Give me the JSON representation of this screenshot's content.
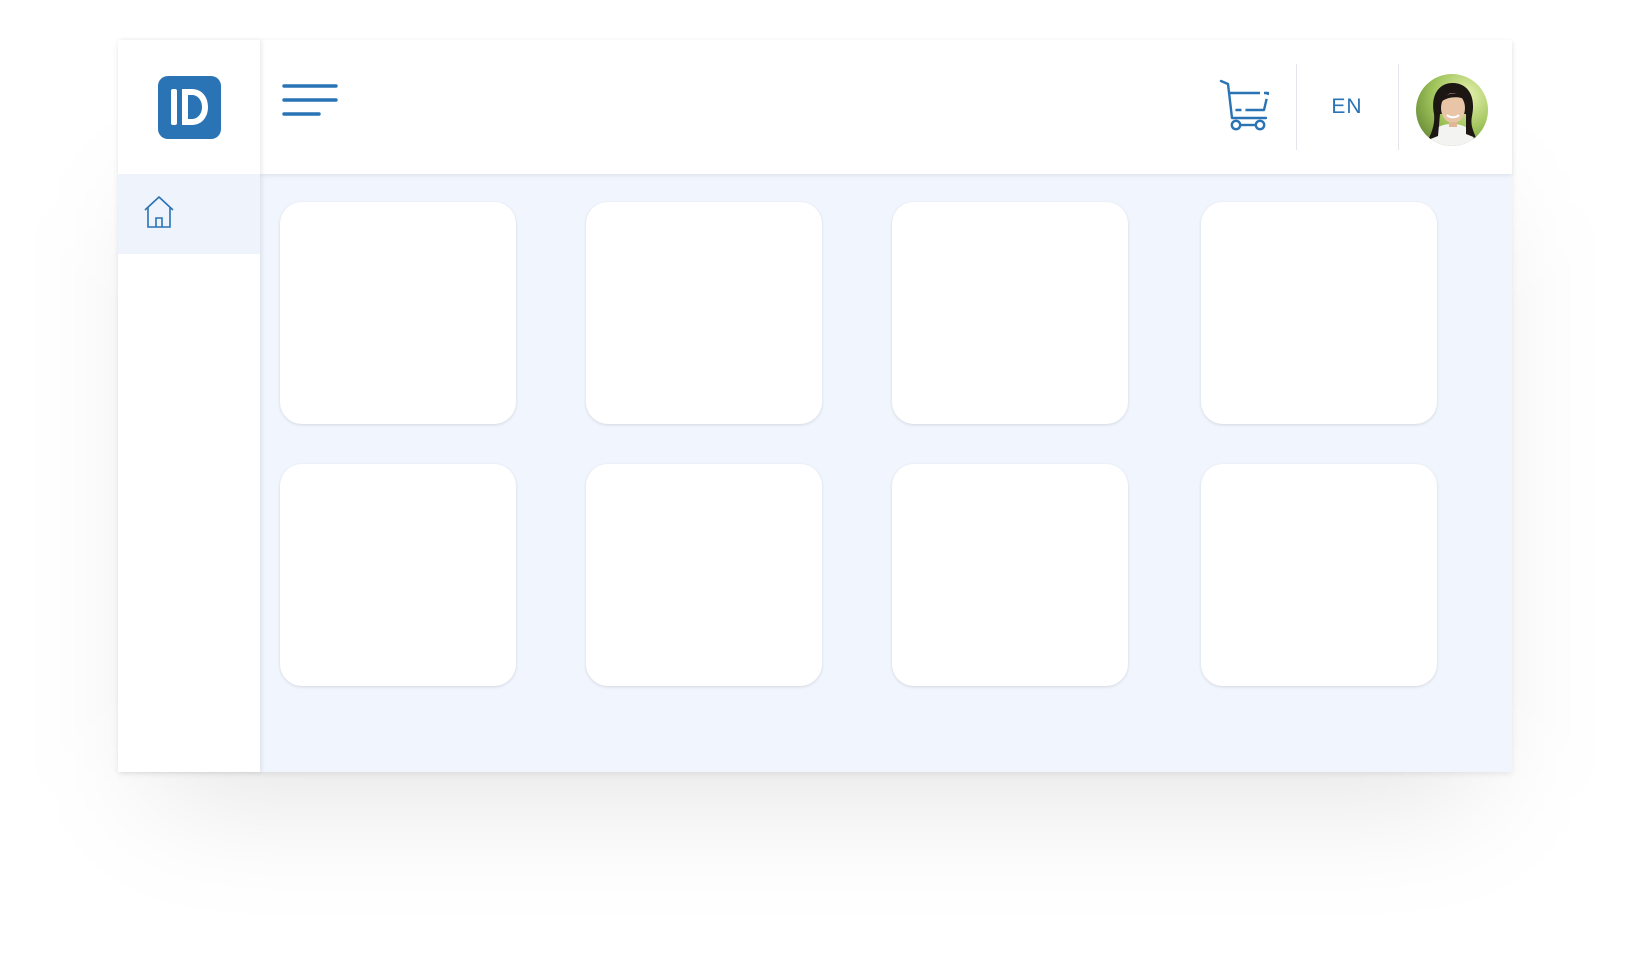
{
  "header": {
    "logo_icon": "id-logo-icon",
    "menu_icon": "hamburger-menu-icon",
    "cart_icon": "shopping-cart-icon",
    "language": "EN",
    "avatar_icon": "user-avatar"
  },
  "sidebar": {
    "items": [
      {
        "icon": "home-icon",
        "active": true
      }
    ]
  },
  "main": {
    "cards": [
      {},
      {},
      {},
      {},
      {},
      {},
      {},
      {}
    ]
  },
  "colors": {
    "accent": "#2a73b5",
    "content_background": "#f1f5fd",
    "active_nav_background": "#eef3fc"
  }
}
